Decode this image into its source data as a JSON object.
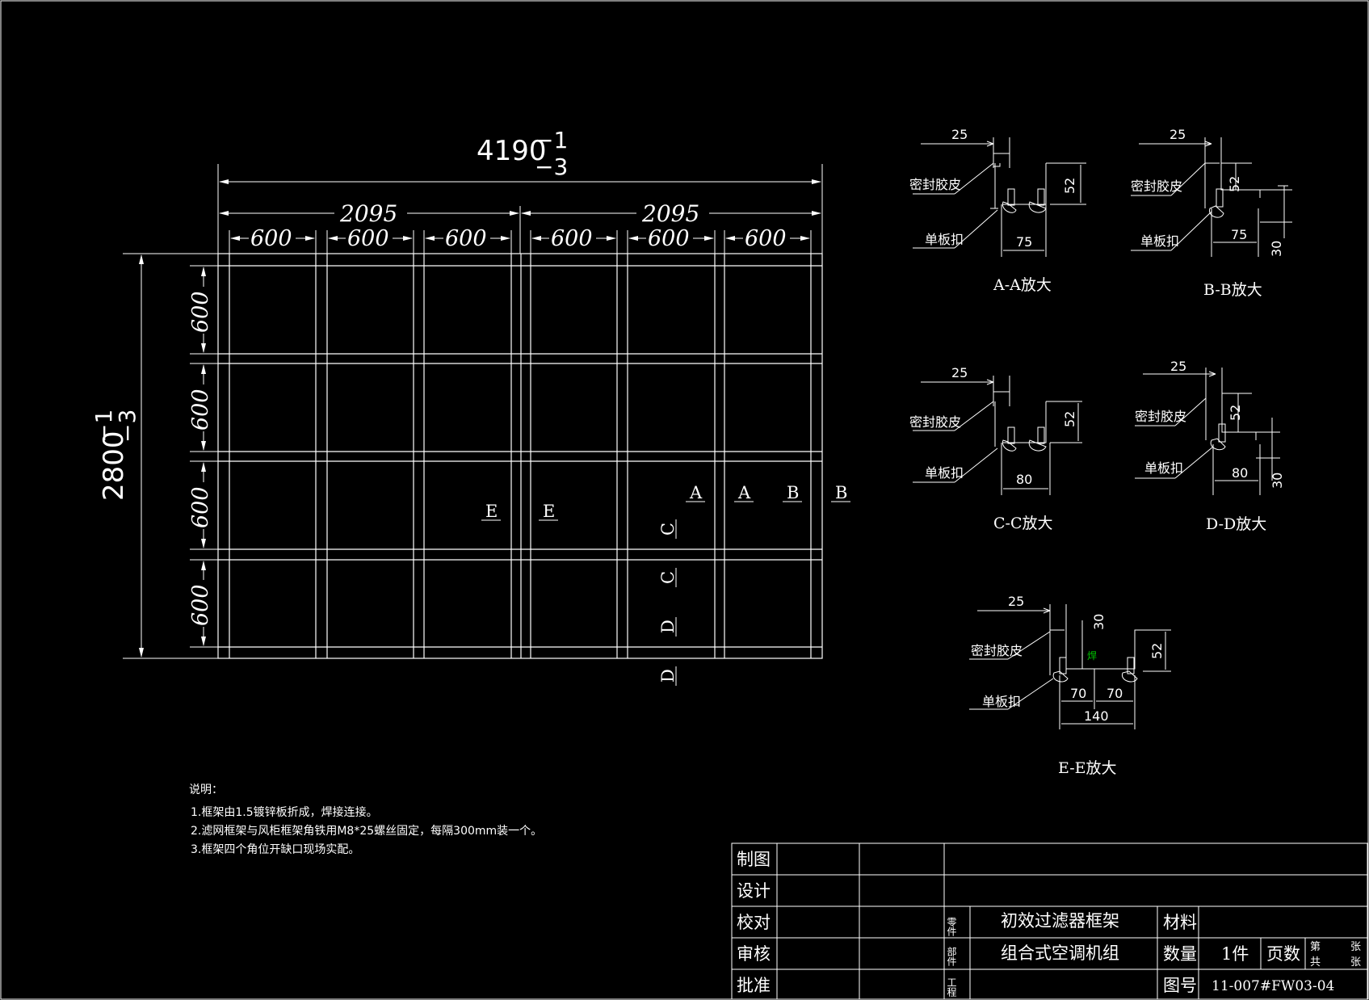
{
  "drawing": {
    "overall_width": "4190",
    "overall_width_tol_upper": "−1",
    "overall_width_tol_lower": "−3",
    "overall_height": "2800",
    "overall_height_tol_upper": "−1",
    "overall_height_tol_lower": "−3",
    "half_width": "2095",
    "module": "600",
    "section_marks": [
      "A",
      "A",
      "B",
      "B",
      "E",
      "E",
      "C",
      "C",
      "D",
      "D"
    ]
  },
  "details": [
    {
      "title": "A-A放大",
      "top": "25",
      "side": "52",
      "bottom": "75",
      "seal": "密封胶皮",
      "clip": "单板扣"
    },
    {
      "title": "B-B放大",
      "top": "25",
      "side": "52",
      "bottom": "75",
      "extra": "30",
      "seal": "密封胶皮",
      "clip": "单板扣"
    },
    {
      "title": "C-C放大",
      "top": "25",
      "side": "52",
      "bottom": "80",
      "seal": "密封胶皮",
      "clip": "单板扣"
    },
    {
      "title": "D-D放大",
      "top": "25",
      "side": "52",
      "bottom": "80",
      "extra": "30",
      "seal": "密封胶皮",
      "clip": "单板扣"
    },
    {
      "title": "E-E放大",
      "top": "25",
      "side": "52",
      "bottom_left": "70",
      "bottom_right": "70",
      "bottom_total": "140",
      "extra": "30",
      "seal": "密封胶皮",
      "clip": "单板扣",
      "small_label": "焊"
    }
  ],
  "notes": {
    "heading": "说明：",
    "items": [
      "1.框架由1.5镀锌板折成，焊接连接。",
      "2.滤网框架与风柜框架角铁用M8*25螺丝固定，每隔300mm装一个。",
      "3.框架四个角位开缺口现场实配。"
    ]
  },
  "title_block": {
    "roles": [
      "制图",
      "设计",
      "校对",
      "审核",
      "批准"
    ],
    "part_label": "零件",
    "component_label": "部件",
    "project_label": "工程",
    "part_name": "初效过滤器框架",
    "component_name": "组合式空调机组",
    "material_label": "材料",
    "quantity_label": "数量",
    "quantity_value": "1件",
    "pages_label": "页数",
    "sheet_no_label": "第",
    "sheet_total_label": "共",
    "sheet_unit": "张",
    "drawing_no_label": "图号",
    "drawing_no_value": "11-007#FW03-04"
  }
}
